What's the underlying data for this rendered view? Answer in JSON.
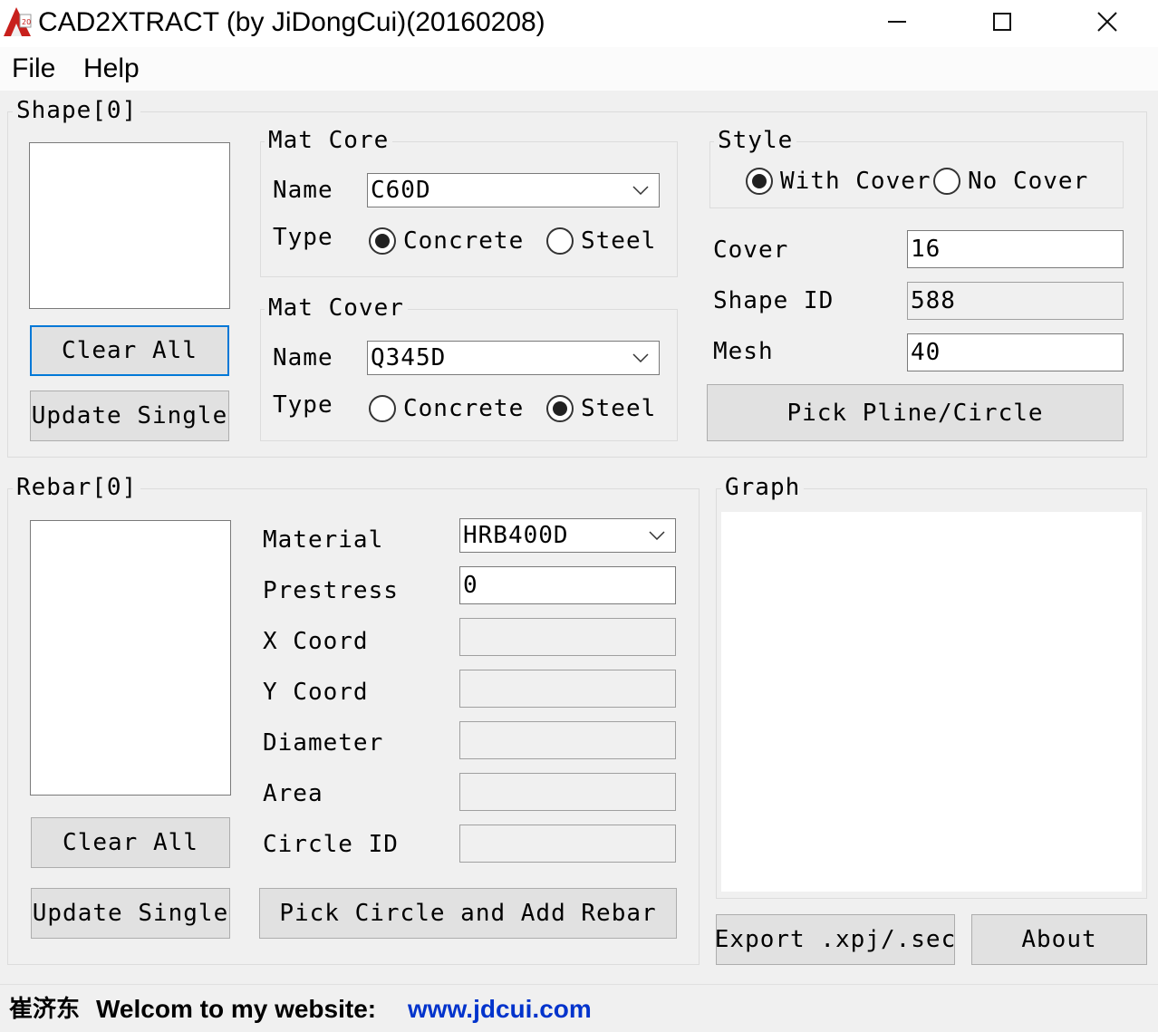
{
  "window": {
    "title": "CAD2XTRACT (by JiDongCui)(20160208)"
  },
  "menu": {
    "file": "File",
    "help": "Help"
  },
  "shape": {
    "group_label": "Shape[0]",
    "clear_all": "Clear All",
    "update_single": "Update Single",
    "mat_core": {
      "label": "Mat Core",
      "name_label": "Name",
      "name_value": "C60D",
      "type_label": "Type",
      "concrete": "Concrete",
      "steel": "Steel",
      "selected": "Concrete"
    },
    "mat_cover": {
      "label": "Mat Cover",
      "name_label": "Name",
      "name_value": "Q345D",
      "type_label": "Type",
      "concrete": "Concrete",
      "steel": "Steel",
      "selected": "Steel"
    },
    "style": {
      "label": "Style",
      "with_cover": "With Cover",
      "no_cover": "No Cover",
      "selected": "With Cover"
    },
    "cover_label": "Cover",
    "cover_value": "16",
    "shape_id_label": "Shape ID",
    "shape_id_value": "588",
    "mesh_label": "Mesh",
    "mesh_value": "40",
    "pick": "Pick Pline/Circle"
  },
  "rebar": {
    "group_label": "Rebar[0]",
    "clear_all": "Clear All",
    "update_single": "Update Single",
    "material_label": "Material",
    "material_value": "HRB400D",
    "prestress_label": "Prestress",
    "prestress_value": "0",
    "x_label": "X Coord",
    "x_value": "",
    "y_label": "Y Coord",
    "y_value": "",
    "diameter_label": "Diameter",
    "diameter_value": "",
    "area_label": "Area",
    "area_value": "",
    "circle_id_label": "Circle ID",
    "circle_id_value": "",
    "pick": "Pick Circle and Add Rebar"
  },
  "graph": {
    "label": "Graph"
  },
  "buttons": {
    "export": "Export .xpj/.sec",
    "about": "About"
  },
  "status": {
    "author": "崔济东",
    "welcome": "Welcom to my website:",
    "website": "www.jdcui.com"
  },
  "colors": {
    "link": "#0033cc",
    "focus": "#0078d7"
  }
}
